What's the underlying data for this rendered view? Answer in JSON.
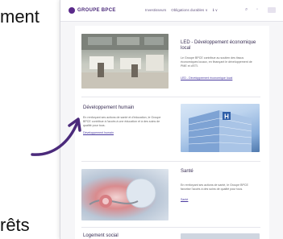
{
  "slide": {
    "text_top": "ment",
    "text_bottom": "rêts"
  },
  "header": {
    "logo_text": "GROUPE BPCE",
    "nav": [
      "Investisseurs",
      "Obligations durables ∨",
      "ℹ ∨"
    ],
    "icons": [
      "search-icon",
      "user-icon",
      "menu-icon"
    ]
  },
  "sections": [
    {
      "title": "LED - Développement économique local",
      "text": "Le Groupe BPCE contribue au soutien des tissus économiques locaux, en finançant le développement de PME et d'ETI.",
      "link": "LED - Développement économique local"
    },
    {
      "title": "Développement humain",
      "text": "En renforçant ses actions de santé et d'éducation, le Groupe BPCE contribue à l'accès à une éducation et à des soins de qualité pour tous.",
      "link": "Développement humain"
    },
    {
      "title": "Santé",
      "text": "En renforçant ses actions de santé, le Groupe BPCE favorise l'accès à des soins de qualité pour tous.",
      "link": "Santé"
    },
    {
      "title": "Logement social"
    }
  ],
  "colors": {
    "brand": "#5a2a8a",
    "arrow": "#4b2a7b",
    "link": "#4a3aa0"
  }
}
